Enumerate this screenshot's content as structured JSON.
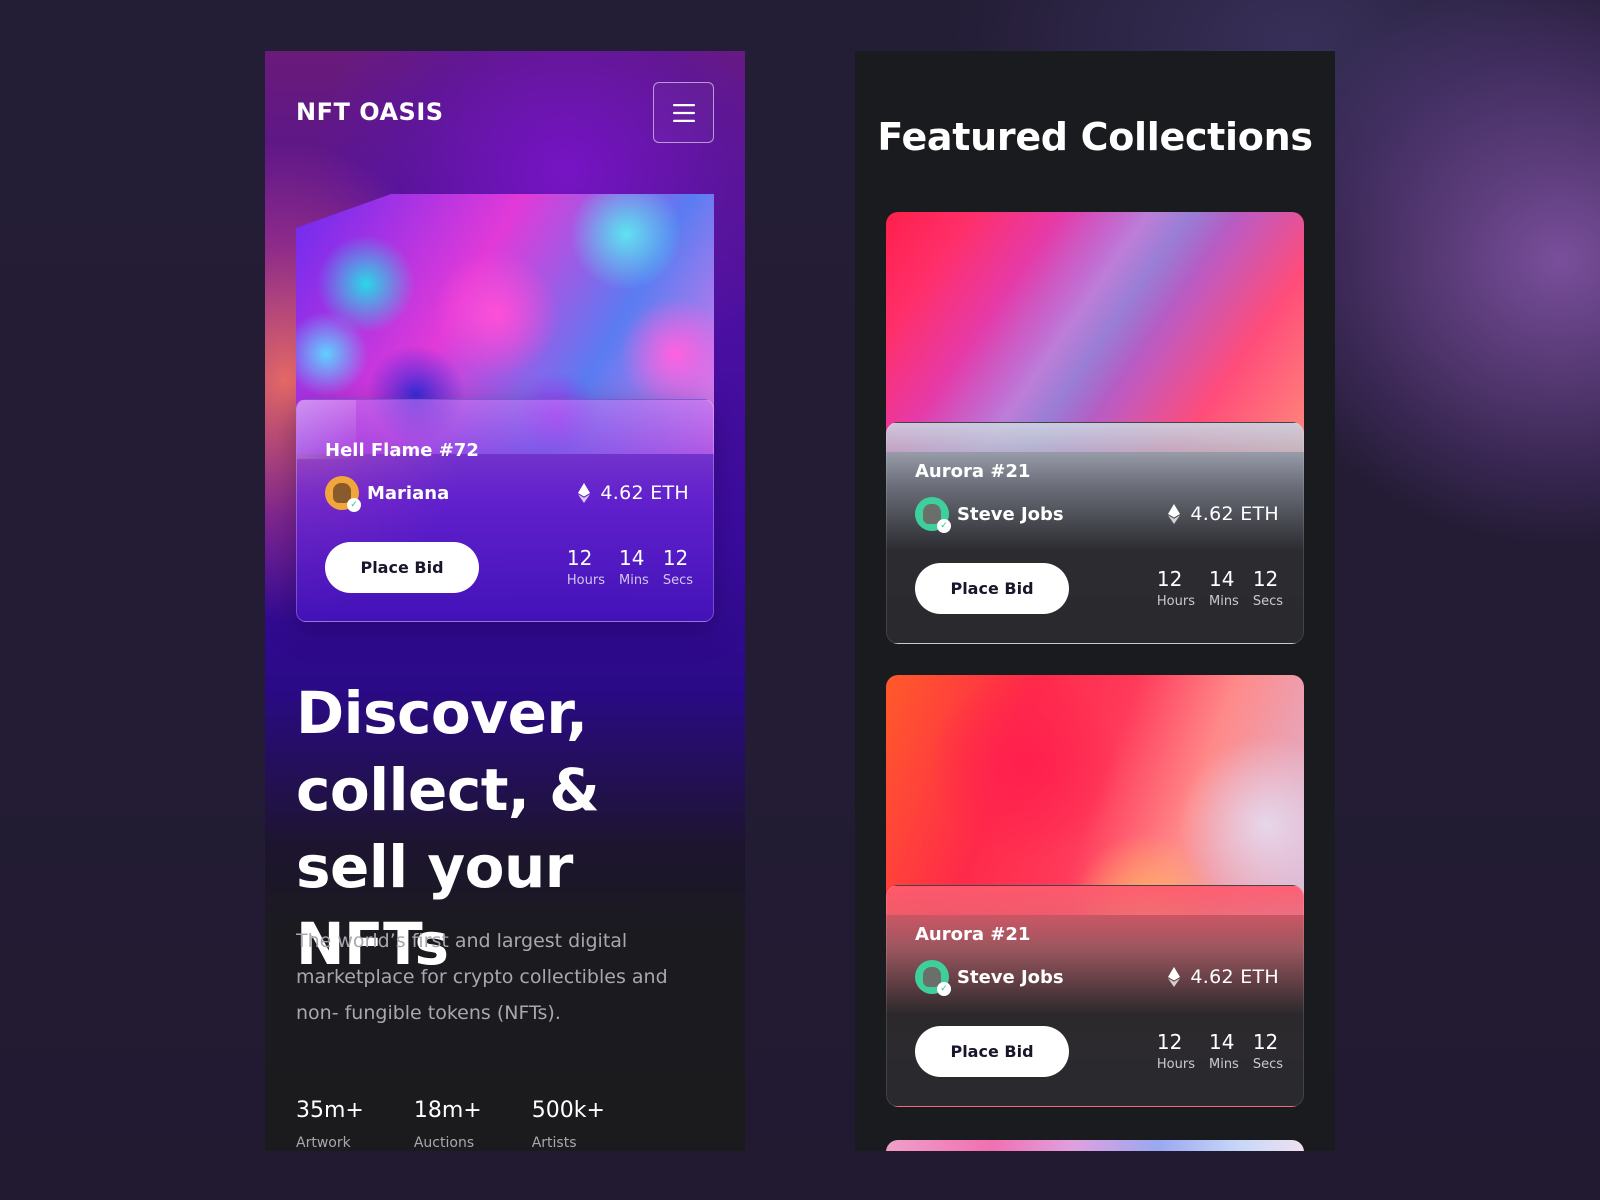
{
  "brand": {
    "logo_text": "NFT OASIS"
  },
  "hero_card": {
    "title": "Hell Flame #72",
    "owner": "Mariana",
    "price": "4.62 ETH",
    "bid_label": "Place Bid",
    "timer": [
      {
        "value": "12",
        "label": "Hours"
      },
      {
        "value": "14",
        "label": "Mins"
      },
      {
        "value": "12",
        "label": "Secs"
      }
    ]
  },
  "hero": {
    "headline": "Discover, collect, & sell your NFTs",
    "subtext": "The world’s first and largest digital marketplace for crypto collectibles and non- fungible tokens (NFTs)."
  },
  "stats": [
    {
      "value": "35m+",
      "label": "Artwork"
    },
    {
      "value": "18m+",
      "label": "Auctions"
    },
    {
      "value": "500k+",
      "label": "Artists"
    }
  ],
  "featured": {
    "title": "Featured Collections",
    "cards": [
      {
        "title": "Aurora #21",
        "owner": "Steve Jobs",
        "price": "4.62 ETH",
        "bid_label": "Place Bid",
        "timer": [
          {
            "value": "12",
            "label": "Hours"
          },
          {
            "value": "14",
            "label": "Mins"
          },
          {
            "value": "12",
            "label": "Secs"
          }
        ]
      },
      {
        "title": "Aurora #21",
        "owner": "Steve Jobs",
        "price": "4.62 ETH",
        "bid_label": "Place Bid",
        "timer": [
          {
            "value": "12",
            "label": "Hours"
          },
          {
            "value": "14",
            "label": "Mins"
          },
          {
            "value": "12",
            "label": "Secs"
          }
        ]
      }
    ]
  },
  "colors": {
    "page_bg": "#221b33",
    "panel_dark": "#1a1b1e",
    "hero_purple": "#3a0b9c",
    "button_bg": "#ffffff",
    "button_text": "#17162a",
    "muted_text": "#a8a7ae"
  },
  "icons": [
    "hamburger-menu-icon",
    "ethereum-icon",
    "verified-check-icon"
  ]
}
